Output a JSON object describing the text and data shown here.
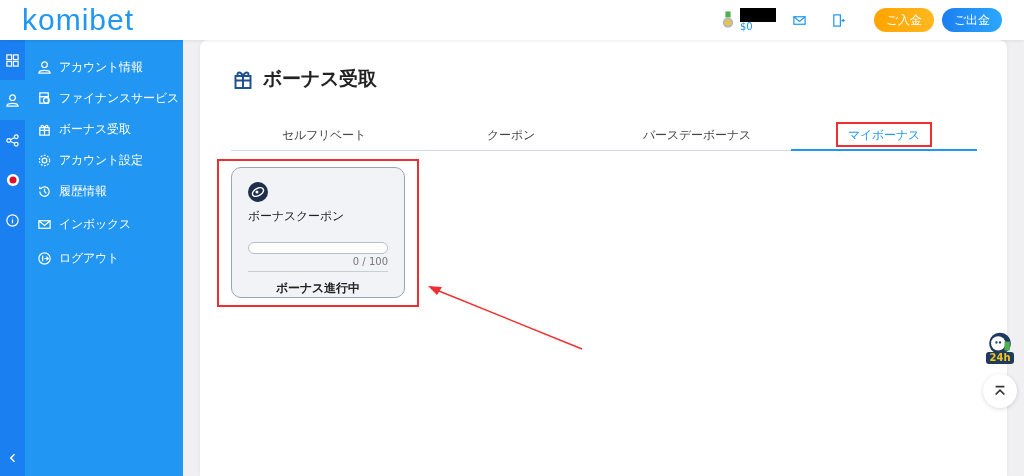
{
  "header": {
    "logo": "komibet",
    "balance": "$0",
    "buttons": [
      {
        "label": "ご入金",
        "kind": "deposit"
      },
      {
        "label": "ご出金",
        "kind": "withdraw"
      }
    ]
  },
  "rail": [
    {
      "selected": false
    },
    {
      "selected": true
    },
    {
      "selected": false
    },
    {
      "selected": false
    },
    {
      "selected": false
    }
  ],
  "sidebar": {
    "items": [
      {
        "label": "アカウント情報"
      },
      {
        "label": "ファイナンスサービス"
      },
      {
        "label": "ボーナス受取"
      },
      {
        "label": "アカウント設定"
      },
      {
        "label": "履歴情報"
      },
      {
        "label": "インボックス"
      },
      {
        "label": "ログアウト"
      }
    ]
  },
  "page": {
    "title": "ボーナス受取",
    "tabs": [
      {
        "label": "セルフリベート",
        "selected": false
      },
      {
        "label": "クーポン",
        "selected": false
      },
      {
        "label": "バースデーボーナス",
        "selected": false
      },
      {
        "label": "マイボーナス",
        "selected": true
      }
    ],
    "bonus_card": {
      "title": "ボーナスクーポン",
      "level": 0,
      "reading": "0 / 100",
      "status": "ボーナス進行中"
    }
  },
  "support": {
    "badge": "24h"
  }
}
